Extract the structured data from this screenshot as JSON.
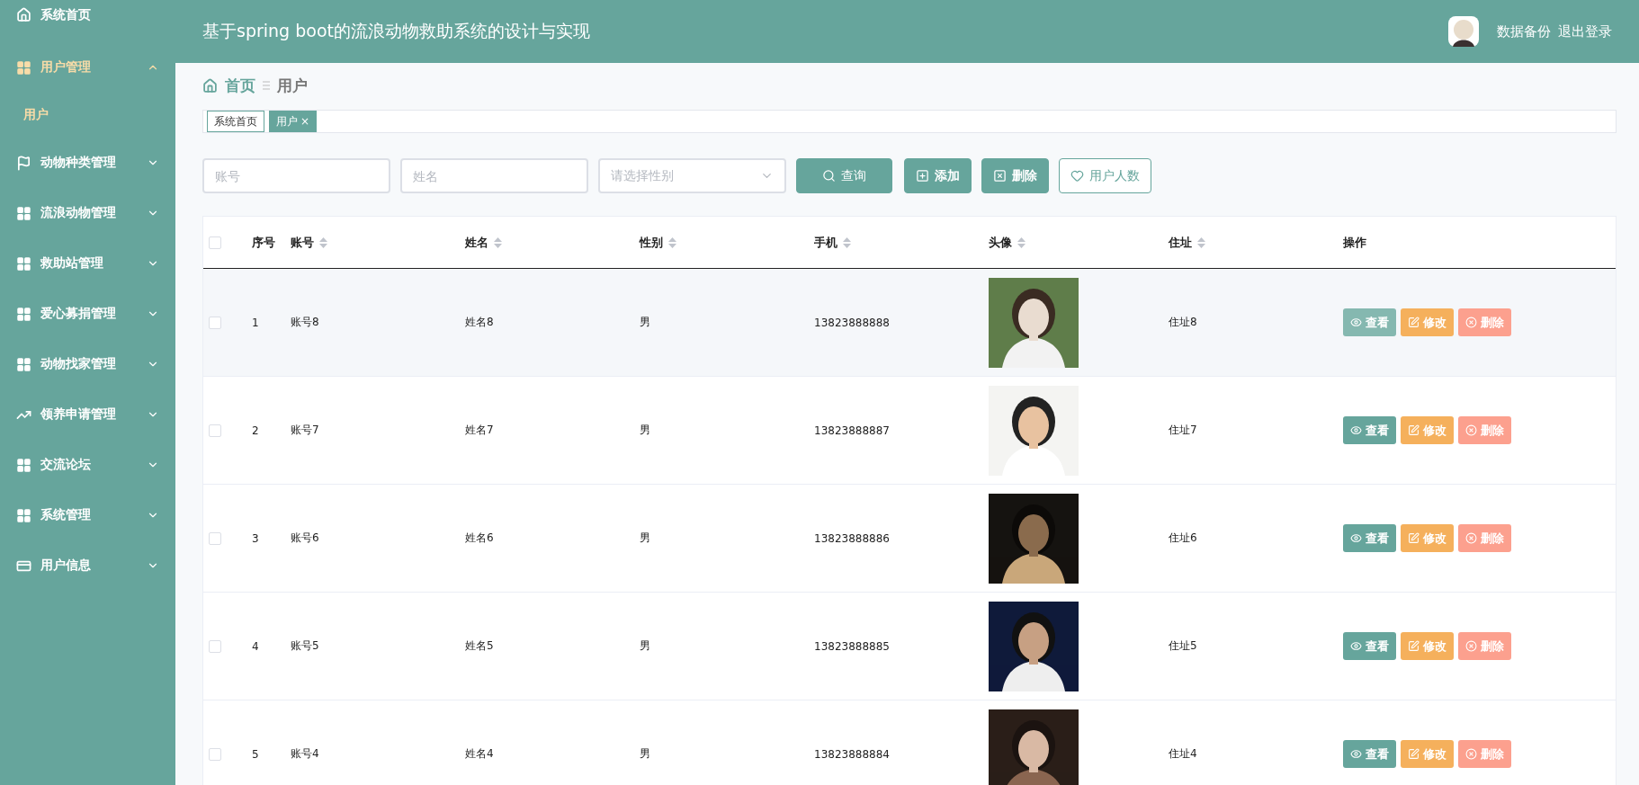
{
  "header": {
    "title": "基于spring boot的流浪动物救助系统的设计与实现",
    "actions": [
      "数据备份",
      "退出登录"
    ]
  },
  "sidebar": {
    "items": [
      {
        "label": "系统首页",
        "kind": "link",
        "expanded": false
      },
      {
        "label": "用户管理",
        "kind": "menu",
        "expanded": true,
        "children": [
          {
            "label": "用户",
            "selected": true
          }
        ]
      },
      {
        "label": "动物种类管理",
        "kind": "menu",
        "expanded": false
      },
      {
        "label": "流浪动物管理",
        "kind": "menu",
        "expanded": false
      },
      {
        "label": "救助站管理",
        "kind": "menu",
        "expanded": false
      },
      {
        "label": "爱心募捐管理",
        "kind": "menu",
        "expanded": false
      },
      {
        "label": "动物找家管理",
        "kind": "menu",
        "expanded": false
      },
      {
        "label": "领养申请管理",
        "kind": "menu",
        "expanded": false
      },
      {
        "label": "交流论坛",
        "kind": "menu",
        "expanded": false
      },
      {
        "label": "系统管理",
        "kind": "menu",
        "expanded": false
      },
      {
        "label": "用户信息",
        "kind": "menu",
        "expanded": false
      }
    ]
  },
  "breadcrumb": [
    "首页",
    "用户"
  ],
  "tags": [
    {
      "label": "系统首页",
      "selected": false
    },
    {
      "label": "用户",
      "selected": true,
      "close": "×"
    }
  ],
  "search": {
    "fields": [
      {
        "kind": "input",
        "placeholder": "账号"
      },
      {
        "kind": "input",
        "placeholder": "姓名"
      },
      {
        "kind": "select",
        "placeholder": "请选择性别"
      }
    ],
    "buttons": [
      {
        "kind": "search",
        "label": "查询"
      },
      {
        "kind": "add",
        "label": "添加"
      },
      {
        "kind": "delete",
        "label": "删除"
      },
      {
        "kind": "stats",
        "label": "用户人数"
      }
    ]
  },
  "table": {
    "all_checked": false,
    "columns": [
      {
        "label": "序号",
        "sortable": false
      },
      {
        "label": "账号",
        "sortable": true
      },
      {
        "label": "姓名",
        "sortable": true
      },
      {
        "label": "性别",
        "sortable": true
      },
      {
        "label": "手机",
        "sortable": true
      },
      {
        "label": "头像",
        "sortable": true
      },
      {
        "label": "住址",
        "sortable": true
      },
      {
        "label": "操作",
        "sortable": false
      }
    ],
    "rows": [
      {
        "index": "1",
        "account": "账号8",
        "name": "姓名8",
        "gender": "男",
        "phone": "13823888888",
        "address": "住址8",
        "hovered": true,
        "checked": false,
        "actions": [
          "查看",
          "修改",
          "删除"
        ]
      },
      {
        "index": "2",
        "account": "账号7",
        "name": "姓名7",
        "gender": "男",
        "phone": "13823888887",
        "address": "住址7",
        "hovered": false,
        "checked": false,
        "actions": [
          "查看",
          "修改",
          "删除"
        ]
      },
      {
        "index": "3",
        "account": "账号6",
        "name": "姓名6",
        "gender": "男",
        "phone": "13823888886",
        "address": "住址6",
        "hovered": false,
        "checked": false,
        "actions": [
          "查看",
          "修改",
          "删除"
        ]
      },
      {
        "index": "4",
        "account": "账号5",
        "name": "姓名5",
        "gender": "男",
        "phone": "13823888885",
        "address": "住址5",
        "hovered": false,
        "checked": false,
        "actions": [
          "查看",
          "修改",
          "删除"
        ]
      },
      {
        "index": "5",
        "account": "账号4",
        "name": "姓名4",
        "gender": "男",
        "phone": "13823888884",
        "address": "住址4",
        "hovered": false,
        "checked": false,
        "actions": [
          "查看",
          "修改",
          "删除"
        ]
      }
    ]
  }
}
